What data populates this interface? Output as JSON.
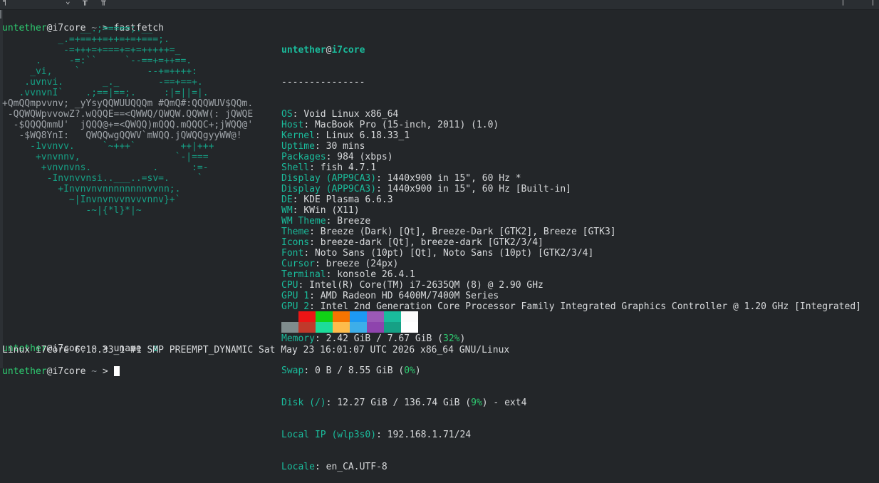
{
  "window": {
    "topbar_icons": [
      "chevron-down-icon",
      "split-view-icon",
      "window-menu-icon",
      "more-icon"
    ]
  },
  "terminal": {
    "prompt_user": "untether",
    "prompt_host_sep": "@",
    "prompt_host": "i7core",
    "prompt_cwd": "~",
    "prompt_arrow": ">",
    "cmd1": "fastfetch",
    "cmd2": "uname",
    "cmd2_arg": "-a",
    "uname_output": "Linux i7core 6.18.33_1 #1 SMP PREEMPT_DYNAMIC Sat May 23 16:01:07 UTC 2026 x86_64 GNU/Linux"
  },
  "logo_lines": [
    "              __.;=====;.__",
    "          _.=+==++=++=+=+===;.",
    "           -=+++=+===+=+=+++++=_",
    "      .     -=:``     `--==+=++==.",
    "     _vi,    `            --+=++++:",
    "    .uvnvi.       _._       -==+==+.",
    "   .vvnvnI`    .;==|==;.     :|=||=|.",
    "+QmQQmpvvnv; _yYsyQQWUUQQQm #QmQ#:QQQWUV$QQm.",
    " -QQWQWpvvowZ?.wQQQE==<QWWQ/QWQW.QQWW(: jQWQE",
    "  -$QQQQmmU'  jQQQ@+=<QWQQ)mQQQ.mQQQC+;jWQQ@'",
    "   -$WQ8YnI:   QWQQwgQQWV`mWQQ.jQWQQgyyWW@!",
    "     -1vvnvv.     `~+++`        ++|+++",
    "      +vnvnnv,                 `-|===",
    "       +vnvnvns.           .      :=-",
    "        -Invnvvnsi..___..=sv=.     `",
    "          +Invnvnvnnnnnnnnvvnn;.",
    "            ~|Invnvnvvnvvvnnv}+`",
    "               -~|{*l}*|~"
  ],
  "info": {
    "header_user": "untether",
    "header_at": "@",
    "header_host": "i7core",
    "separator": "---------------",
    "rows": [
      {
        "key": "OS",
        "value": "Void Linux x86_64"
      },
      {
        "key": "Host",
        "value": "MacBook Pro (15-inch, 2011) (1.0)"
      },
      {
        "key": "Kernel",
        "value": "Linux 6.18.33_1"
      },
      {
        "key": "Uptime",
        "value": "30 mins"
      },
      {
        "key": "Packages",
        "value": "984 (xbps)"
      },
      {
        "key": "Shell",
        "value": "fish 4.7.1"
      },
      {
        "key": "Display (APP9CA3)",
        "value": "1440x900 in 15\", 60 Hz *"
      },
      {
        "key": "Display (APP9CA3)",
        "value": "1440x900 in 15\", 60 Hz [Built-in]"
      },
      {
        "key": "DE",
        "value": "KDE Plasma 6.6.3"
      },
      {
        "key": "WM",
        "value": "KWin (X11)"
      },
      {
        "key": "WM Theme",
        "value": "Breeze"
      },
      {
        "key": "Theme",
        "value": "Breeze (Dark) [Qt], Breeze-Dark [GTK2], Breeze [GTK3]"
      },
      {
        "key": "Icons",
        "value": "breeze-dark [Qt], breeze-dark [GTK2/3/4]"
      },
      {
        "key": "Font",
        "value": "Noto Sans (10pt) [Qt], Noto Sans (10pt) [GTK2/3/4]"
      },
      {
        "key": "Cursor",
        "value": "breeze (24px)"
      },
      {
        "key": "Terminal",
        "value": "konsole 26.4.1"
      },
      {
        "key": "CPU",
        "value": "Intel(R) Core(TM) i7-2635QM (8) @ 2.90 GHz"
      },
      {
        "key": "GPU 1",
        "value": "AMD Radeon HD 6400M/7400M Series"
      },
      {
        "key": "GPU 2",
        "value": "Intel 2nd Generation Core Processor Family Integrated Graphics Controller @ 1.20 GHz [Integrated]"
      }
    ],
    "memory": {
      "key": "Memory",
      "pre": "2.42 GiB / 7.67 GiB (",
      "pct": "32%",
      "post": ")"
    },
    "swap": {
      "key": "Swap",
      "pre": "0 B / 8.55 GiB (",
      "pct": "0%",
      "post": ")"
    },
    "disk": {
      "key": "Disk (/)",
      "pre": "12.27 GiB / 136.74 GiB (",
      "pct": "9%",
      "post": ") - ext4"
    },
    "local_ip": {
      "key": "Local IP (wlp3s0)",
      "value": "192.168.1.71/24"
    },
    "locale": {
      "key": "Locale",
      "value": "en_CA.UTF-8"
    }
  },
  "palette": {
    "row1": [
      "#232629",
      "#ed1515",
      "#11d116",
      "#f67400",
      "#1d99f3",
      "#9b59b6",
      "#1abc9c",
      "#fcfcfc"
    ],
    "row2": [
      "#7f8c8d",
      "#c0392b",
      "#1cdc9a",
      "#fdbc4b",
      "#3daee9",
      "#8e44ad",
      "#16a085",
      "#ffffff"
    ]
  }
}
